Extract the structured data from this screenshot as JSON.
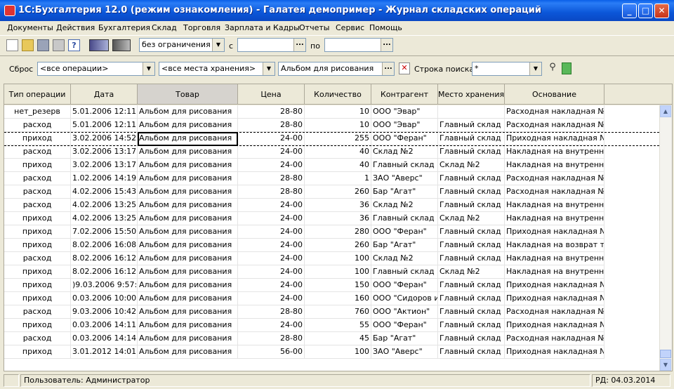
{
  "window": {
    "title": "1С:Бухгалтерия 12.0 (режим ознакомления) - Галатея демопример - Журнал складских операций"
  },
  "menu": [
    "Документы",
    "Действия",
    "Бухгалтерия",
    "Склад",
    "Торговля",
    "Зарплата и Кадры",
    "Отчеты",
    "Сервис",
    "Помощь"
  ],
  "toolbar": {
    "period": "без ограничения",
    "from_label": "с",
    "from_value": "",
    "to_label": "по",
    "to_value": ""
  },
  "filters": {
    "reset_label": "Сброс",
    "operation": "<все операции>",
    "storage": "<все места хранения>",
    "item": "Альбом для рисования",
    "search_label": "Строка поиска",
    "search_value": "*"
  },
  "columns": [
    "Тип операции",
    "Дата",
    "Товар",
    "Цена",
    "Количество",
    "Контрагент",
    "Место хранения",
    "Основание"
  ],
  "rows": [
    {
      "type": "нет_резерв",
      "date": "5.01.2006 12:11:3",
      "item": "Альбом для рисования",
      "price": "28-80",
      "qty": "10",
      "party": "ООО \"Эвар\"",
      "place": "",
      "basis": "Расходная накладная №00"
    },
    {
      "type": "расход",
      "date": "5.01.2006 12:11:3",
      "item": "Альбом для рисования",
      "price": "28-80",
      "qty": "10",
      "party": "ООО \"Эвар\"",
      "place": "Главный склад",
      "basis": "Расходная накладная №00"
    },
    {
      "type": "приход",
      "date": "3.02.2006 14:52:5",
      "item": "Альбом для рисования",
      "price": "24-00",
      "qty": "255",
      "party": "ООО \"Феран\"",
      "place": "Главный склад",
      "basis": "Приходная накладная №9:"
    },
    {
      "type": "расход",
      "date": "3.02.2006 13:17:3",
      "item": "Альбом для рисования",
      "price": "24-00",
      "qty": "40",
      "party": "Склад №2",
      "place": "Главный склад",
      "basis": "Накладная на внутреннее п"
    },
    {
      "type": "приход",
      "date": "3.02.2006 13:17:3",
      "item": "Альбом для рисования",
      "price": "24-00",
      "qty": "40",
      "party": "Главный склад",
      "place": "Склад №2",
      "basis": "Накладная на внутреннее п"
    },
    {
      "type": "расход",
      "date": "1.02.2006 14:19:2",
      "item": "Альбом для рисования",
      "price": "28-80",
      "qty": "1",
      "party": "ЗАО \"Аверс\"",
      "place": "Главный склад",
      "basis": "Расходная накладная №00"
    },
    {
      "type": "расход",
      "date": "4.02.2006 15:43:2",
      "item": "Альбом для рисования",
      "price": "28-80",
      "qty": "260",
      "party": "Бар \"Агат\"",
      "place": "Главный склад",
      "basis": "Расходная накладная №00"
    },
    {
      "type": "расход",
      "date": "4.02.2006 13:25:5",
      "item": "Альбом для рисования",
      "price": "24-00",
      "qty": "36",
      "party": "Склад №2",
      "place": "Главный склад",
      "basis": "Накладная на внутреннее п"
    },
    {
      "type": "приход",
      "date": "4.02.2006 13:25:5",
      "item": "Альбом для рисования",
      "price": "24-00",
      "qty": "36",
      "party": "Главный склад",
      "place": "Склад №2",
      "basis": "Накладная на внутреннее п"
    },
    {
      "type": "приход",
      "date": "7.02.2006 15:50:2",
      "item": "Альбом для рисования",
      "price": "24-00",
      "qty": "280",
      "party": "ООО \"Феран\"",
      "place": "Главный склад",
      "basis": "Приходная накладная №1:"
    },
    {
      "type": "приход",
      "date": "8.02.2006 16:08:4",
      "item": "Альбом для рисования",
      "price": "24-00",
      "qty": "260",
      "party": "Бар \"Агат\"",
      "place": "Главный склад",
      "basis": "Накладная на возврат това"
    },
    {
      "type": "расход",
      "date": "8.02.2006 16:12:2",
      "item": "Альбом для рисования",
      "price": "24-00",
      "qty": "100",
      "party": "Склад №2",
      "place": "Главный склад",
      "basis": "Накладная на внутреннее п"
    },
    {
      "type": "приход",
      "date": "8.02.2006 16:12:2",
      "item": "Альбом для рисования",
      "price": "24-00",
      "qty": "100",
      "party": "Главный склад",
      "place": "Склад №2",
      "basis": "Накладная на внутреннее п"
    },
    {
      "type": "приход",
      "date": ")9.03.2006 9:57:25",
      "item": "Альбом для рисования",
      "price": "24-00",
      "qty": "150",
      "party": "ООО \"Феран\"",
      "place": "Главный склад",
      "basis": "Приходная накладная №1("
    },
    {
      "type": "приход",
      "date": "0.03.2006 10:00:0",
      "item": "Альбом для рисования",
      "price": "24-00",
      "qty": "160",
      "party": "ООО \"Сидоров и К",
      "place": "Главный склад",
      "basis": "Приходная накладная №1("
    },
    {
      "type": "расход",
      "date": "9.03.2006 10:42:3",
      "item": "Альбом для рисования",
      "price": "28-80",
      "qty": "760",
      "party": "ООО \"Актион\"",
      "place": "Главный склад",
      "basis": "Расходная накладная №00"
    },
    {
      "type": "приход",
      "date": "0.03.2006 14:11:5",
      "item": "Альбом для рисования",
      "price": "24-00",
      "qty": "55",
      "party": "ООО \"Феран\"",
      "place": "Главный склад",
      "basis": "Приходная накладная №2!"
    },
    {
      "type": "расход",
      "date": "0.03.2006 14:14:5",
      "item": "Альбом для рисования",
      "price": "28-80",
      "qty": "45",
      "party": "Бар \"Агат\"",
      "place": "Главный склад",
      "basis": "Расходная накладная №00"
    },
    {
      "type": "приход",
      "date": "3.01.2012 14:01:0",
      "item": "Альбом для рисования",
      "price": "56-00",
      "qty": "100",
      "party": "ЗАО \"Аверс\"",
      "place": "Главный склад",
      "basis": "Приходная накладная №3("
    }
  ],
  "status": {
    "user": "Пользователь: Администратор",
    "date": "РД: 04.03.2014"
  }
}
